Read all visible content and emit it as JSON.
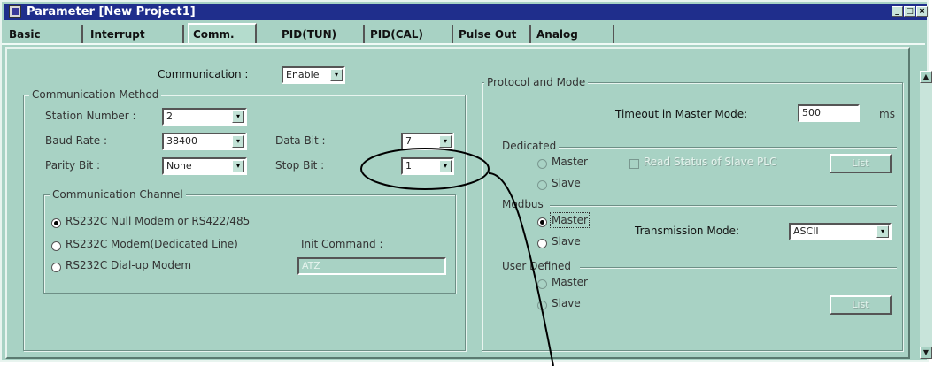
{
  "window": {
    "title": "Parameter [New Project1]",
    "min_glyph": "_",
    "max_glyph": "□",
    "close_glyph": "×"
  },
  "tabs": [
    "Basic",
    "Interrupt",
    "Comm.",
    "PID(TUN)",
    "PID(CAL)",
    "Pulse Out",
    "Analog"
  ],
  "active_tab": "Comm.",
  "comm": {
    "label": "Communication :",
    "value": "Enable",
    "method": {
      "legend": "Communication Method",
      "station_label": "Station Number :",
      "station_value": "2",
      "baud_label": "Baud Rate :",
      "baud_value": "38400",
      "databit_label": "Data Bit :",
      "databit_value": "7",
      "parity_label": "Parity Bit :",
      "parity_value": "None",
      "stopbit_label": "Stop Bit :",
      "stopbit_value": "1"
    },
    "channel": {
      "legend": "Communication Channel",
      "options": [
        "RS232C Null Modem or RS422/485",
        "RS232C Modem(Dedicated Line)",
        "RS232C Dial-up Modem"
      ],
      "selected_index": 0,
      "init_label": "Init Command :",
      "init_value": "ATZ"
    }
  },
  "protocol": {
    "legend": "Protocol and Mode",
    "timeout_label": "Timeout in Master Mode:",
    "timeout_value": "500",
    "timeout_unit": "ms",
    "dedicated": {
      "legend": "Dedicated",
      "master": "Master",
      "slave": "Slave",
      "read_status": "Read Status of Slave PLC",
      "list_button": "List"
    },
    "modbus": {
      "legend": "Modbus",
      "master": "Master",
      "slave": "Slave",
      "selected": "Master",
      "trans_label": "Transmission Mode:",
      "trans_value": "ASCII"
    },
    "user": {
      "legend": "User Defined",
      "master": "Master",
      "slave": "Slave",
      "list_button": "List"
    }
  },
  "icons": {
    "dropdown": "▾",
    "scroll_up": "▲",
    "scroll_down": "▼"
  }
}
